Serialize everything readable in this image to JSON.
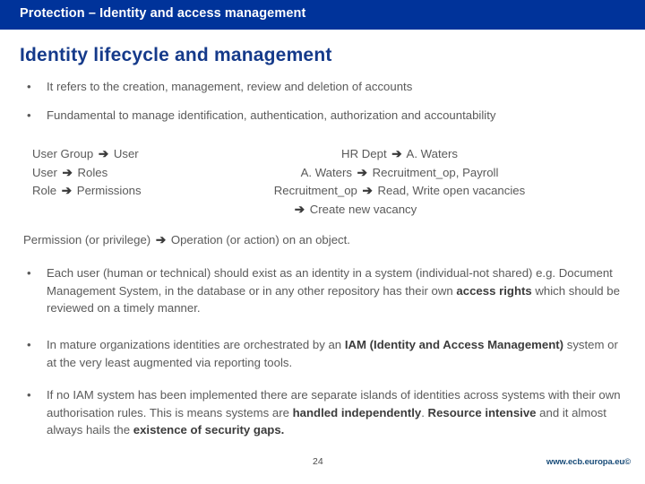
{
  "header": {
    "title": "Protection – Identity and access management",
    "background_color": "#00339A",
    "text_color": "#FFFFFF"
  },
  "slide": {
    "title": "Identity lifecycle and management",
    "title_color": "#153A8A",
    "body_text_color": "#5A5A5A",
    "bullet_marker": "•",
    "arrow_glyph": "➔"
  },
  "bullets": {
    "intro": [
      {
        "text": "It refers to the creation, management, review and deletion of accounts"
      },
      {
        "text": "Fundamental to manage identification, authentication, authorization and accountability"
      }
    ]
  },
  "mapping_diagram": {
    "left_column": [
      {
        "source": "User Group",
        "target": "User"
      },
      {
        "source": "User",
        "target": "Roles"
      },
      {
        "source": "Role",
        "target": "Permissions"
      }
    ],
    "right_column": [
      {
        "source": "HR Dept",
        "target": "A. Waters"
      },
      {
        "source": "A. Waters",
        "target": "Recruitment_op, Payroll"
      },
      {
        "source": "Recruitment_op",
        "target": "Read, Write open vacancies"
      },
      {
        "source": "",
        "target": "Create new vacancy"
      }
    ]
  },
  "permission_line": {
    "left": "Permission (or privilege)",
    "right": "Operation (or action) on an object."
  },
  "detail_bullets": [
    {
      "segments": [
        {
          "text": "Each user (human or technical) should exist as an identity in a system (individual-not shared) e.g. Document Management System, in the database or in any other repository has their own ",
          "bold": false
        },
        {
          "text": "access rights",
          "bold": true
        },
        {
          "text": " which should be reviewed on a timely manner.",
          "bold": false
        }
      ]
    },
    {
      "segments": [
        {
          "text": "In mature organizations identities are orchestrated by an ",
          "bold": false
        },
        {
          "text": "IAM (Identity and Access Management)",
          "bold": true
        },
        {
          "text": " system or at the very least augmented via reporting tools.",
          "bold": false
        }
      ]
    },
    {
      "segments": [
        {
          "text": "If no IAM system has been implemented there are separate islands of identities across systems with their own authorisation rules. This is means systems are ",
          "bold": false
        },
        {
          "text": "handled independently",
          "bold": true
        },
        {
          "text": ". ",
          "bold": false
        },
        {
          "text": "Resource intensive",
          "bold": true
        },
        {
          "text": " and it almost always hails the ",
          "bold": false
        },
        {
          "text": "existence of security gaps.",
          "bold": true
        }
      ]
    }
  ],
  "footer": {
    "page_number": "24",
    "url": "www.ecb.europa.eu",
    "copyright_symbol": "©",
    "url_color": "#184B78"
  }
}
